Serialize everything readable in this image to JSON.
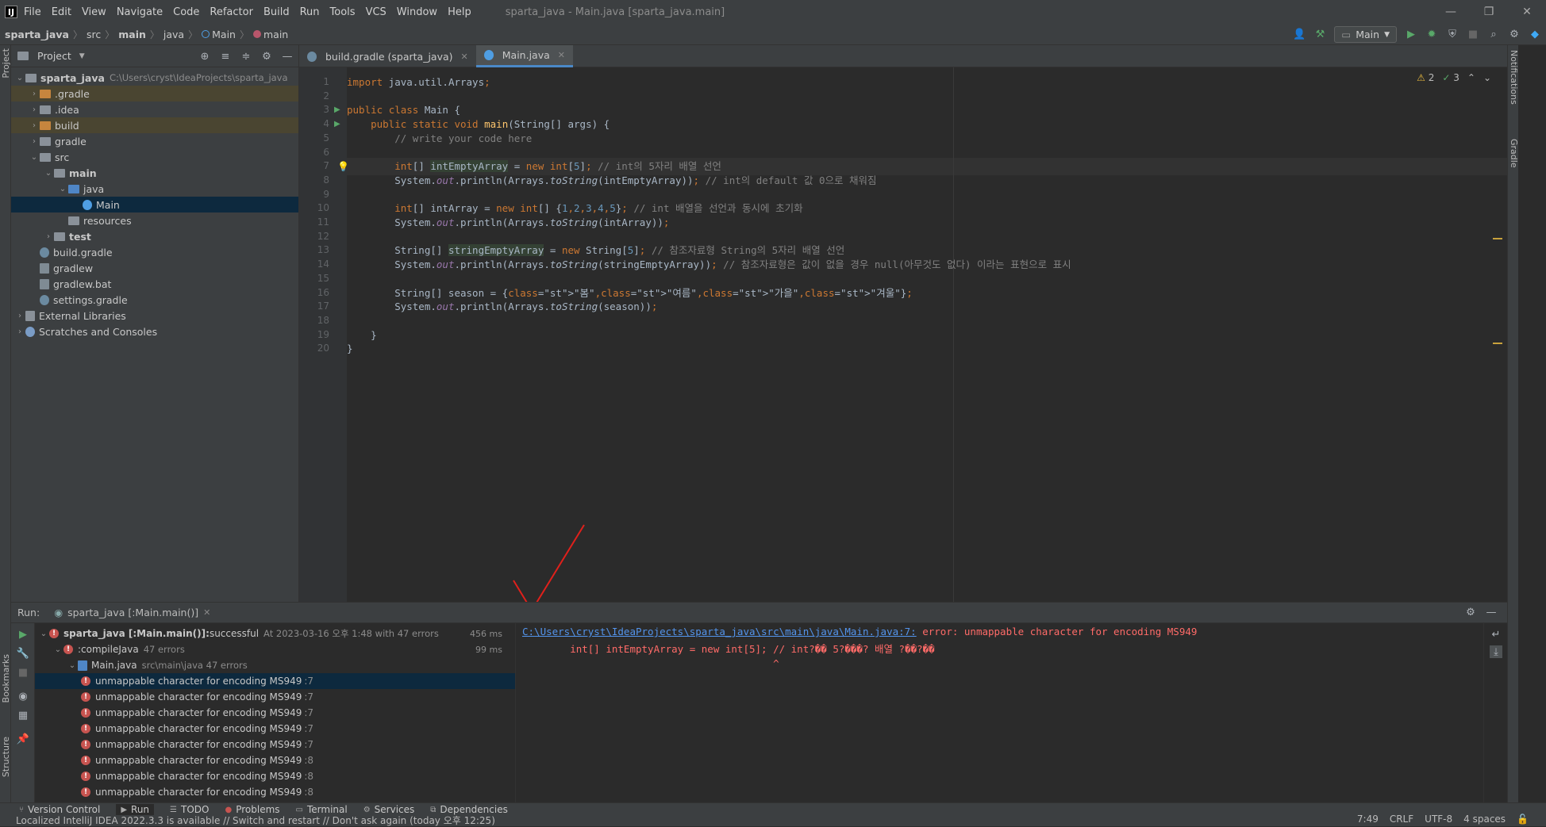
{
  "window": {
    "app_badge": "IJ",
    "title": "sparta_java - Main.java [sparta_java.main]",
    "menu": [
      "File",
      "Edit",
      "View",
      "Navigate",
      "Code",
      "Refactor",
      "Build",
      "Run",
      "Tools",
      "VCS",
      "Window",
      "Help"
    ]
  },
  "breadcrumb": [
    "sparta_java",
    "src",
    "main",
    "java",
    "Main",
    "main"
  ],
  "toolbar": {
    "run_config": "Main"
  },
  "project_panel": {
    "title": "Project",
    "tree": [
      {
        "label": "sparta_java",
        "hint": "C:\\Users\\cryst\\IdeaProjects\\sparta_java",
        "depth": 0,
        "bold": true,
        "folder": "gray",
        "expanded": true
      },
      {
        "label": ".gradle",
        "depth": 1,
        "folder": "orange",
        "collapsed": true,
        "hl": true
      },
      {
        "label": ".idea",
        "depth": 1,
        "folder": "gray",
        "collapsed": true
      },
      {
        "label": "build",
        "depth": 1,
        "folder": "orange",
        "collapsed": true,
        "hl": true
      },
      {
        "label": "gradle",
        "depth": 1,
        "folder": "gray",
        "collapsed": true
      },
      {
        "label": "src",
        "depth": 1,
        "folder": "gray",
        "expanded": true
      },
      {
        "label": "main",
        "depth": 2,
        "folder": "gray",
        "expanded": true,
        "bold": true
      },
      {
        "label": "java",
        "depth": 3,
        "folder": "blue",
        "expanded": true
      },
      {
        "label": "Main",
        "depth": 4,
        "file": "class",
        "sel": true
      },
      {
        "label": "resources",
        "depth": 3,
        "folder": "gray"
      },
      {
        "label": "test",
        "depth": 2,
        "folder": "gray",
        "collapsed": true,
        "bold": true
      },
      {
        "label": "build.gradle",
        "depth": 1,
        "file": "gradle"
      },
      {
        "label": "gradlew",
        "depth": 1,
        "file": "script"
      },
      {
        "label": "gradlew.bat",
        "depth": 1,
        "file": "text"
      },
      {
        "label": "settings.gradle",
        "depth": 1,
        "file": "gradle"
      },
      {
        "label": "External Libraries",
        "depth": 0,
        "file": "lib",
        "collapsed": true
      },
      {
        "label": "Scratches and Consoles",
        "depth": 0,
        "file": "scratch",
        "collapsed": true
      }
    ]
  },
  "editor": {
    "tabs": [
      {
        "label": "build.gradle (sparta_java)",
        "active": false
      },
      {
        "label": "Main.java",
        "active": true
      }
    ],
    "inspections": {
      "warnings": "2",
      "ok": "3"
    },
    "line_numbers": [
      "1",
      "2",
      "3",
      "4",
      "5",
      "6",
      "7",
      "8",
      "9",
      "10",
      "11",
      "12",
      "13",
      "14",
      "15",
      "16",
      "17",
      "18",
      "19",
      "20"
    ],
    "lines": [
      "import java.util.Arrays;",
      "",
      "public class Main {",
      "    public static void main(String[] args) {",
      "        // write your code here",
      "",
      "        int[] intEmptyArray = new int[5]; // int의 5자리 배열 선언",
      "        System.out.println(Arrays.toString(intEmptyArray)); // int의 default 값 0으로 채워짐",
      "",
      "        int[] intArray = new int[] {1,2,3,4,5}; // int 배열을 선언과 동시에 초기화",
      "        System.out.println(Arrays.toString(intArray));",
      "",
      "        String[] stringEmptyArray = new String[5]; // 참조자료형 String의 5자리 배열 선언",
      "        System.out.println(Arrays.toString(stringEmptyArray)); // 참조자료형은 값이 없을 경우 null(아무것도 없다) 이라는 표현으로 표시",
      "",
      "        String[] season = {\"봄\",\"여름\",\"가을\",\"겨울\"};",
      "        System.out.println(Arrays.toString(season));",
      "",
      "    }",
      "}"
    ]
  },
  "run_panel": {
    "label": "Run:",
    "tab": "sparta_java [:Main.main()]",
    "tree": [
      {
        "label": "sparta_java [:Main.main()]:",
        "status": " successful",
        "detail": "At 2023-03-16 오후 1:48 with 47 errors",
        "time": "456 ms",
        "depth": 0
      },
      {
        "label": ":compileJava",
        "detail": "47 errors",
        "time": "99 ms",
        "depth": 1
      },
      {
        "label": "Main.java",
        "detail": "src\\main\\java 47 errors",
        "depth": 2,
        "noerr": true
      },
      {
        "label": "unmappable character for encoding MS949",
        "line": ":7",
        "depth": 3,
        "sel": true
      },
      {
        "label": "unmappable character for encoding MS949",
        "line": ":7",
        "depth": 3
      },
      {
        "label": "unmappable character for encoding MS949",
        "line": ":7",
        "depth": 3
      },
      {
        "label": "unmappable character for encoding MS949",
        "line": ":7",
        "depth": 3
      },
      {
        "label": "unmappable character for encoding MS949",
        "line": ":7",
        "depth": 3
      },
      {
        "label": "unmappable character for encoding MS949",
        "line": ":8",
        "depth": 3
      },
      {
        "label": "unmappable character for encoding MS949",
        "line": ":8",
        "depth": 3
      },
      {
        "label": "unmappable character for encoding MS949",
        "line": ":8",
        "depth": 3
      }
    ],
    "console": {
      "path": "C:\\Users\\cryst\\IdeaProjects\\sparta_java\\src\\main\\java\\Main.java:7:",
      "error": " error: unmappable character for encoding MS949",
      "code_line": "        int[] intEmptyArray = new int[5]; // int?�� 5?���? 배열 ?��?��",
      "caret": "                                          ^"
    }
  },
  "bottom_tabs": [
    "Version Control",
    "Run",
    "TODO",
    "Problems",
    "Terminal",
    "Services",
    "Dependencies"
  ],
  "status": {
    "message": "Localized IntelliJ IDEA 2022.3.3 is available // Switch and restart // Don't ask again (today 오후 12:25)",
    "position": "7:49",
    "line_sep": "CRLF",
    "encoding": "UTF-8",
    "indent": "4 spaces"
  },
  "side_labels": {
    "left_top": "Project",
    "left_bookmarks": "Bookmarks",
    "left_structure": "Structure",
    "right_notifications": "Notifications",
    "right_gradle": "Gradle"
  },
  "colors": {
    "accent": "#4a88c7",
    "error": "#c75450",
    "selection": "#0d293e",
    "annotation": "#e0201b"
  }
}
